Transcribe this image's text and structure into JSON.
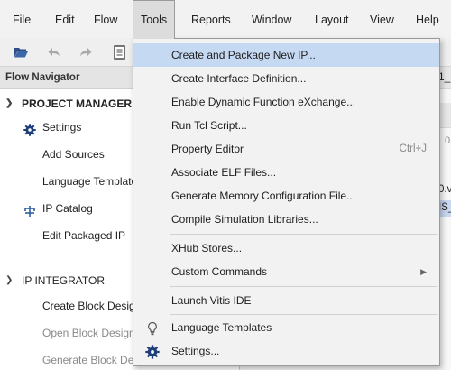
{
  "menubar": {
    "items": [
      "File",
      "Edit",
      "Flow",
      "Tools",
      "Reports",
      "Window",
      "Layout",
      "View",
      "Help"
    ],
    "active": "Tools"
  },
  "toolbar": {
    "icons": [
      "open-project-icon",
      "undo-icon",
      "redo-icon",
      "document-icon"
    ]
  },
  "flow_navigator": {
    "title": "Flow Navigator",
    "project_manager": {
      "label": "PROJECT MANAGER",
      "items": [
        {
          "label": "Settings",
          "icon": "gear-icon"
        },
        {
          "label": "Add Sources"
        },
        {
          "label": "Language Templates"
        },
        {
          "label": "IP Catalog",
          "icon": "ip-catalog-icon"
        },
        {
          "label": "Edit Packaged IP"
        }
      ]
    },
    "ip_integrator": {
      "label": "IP INTEGRATOR",
      "items": [
        {
          "label": "Create Block Design",
          "dim": false
        },
        {
          "label": "Open Block Design",
          "dim": true
        },
        {
          "label": "Generate Block Design",
          "dim": true
        }
      ]
    }
  },
  "right_panel": {
    "fragments": [
      "1_",
      "0",
      "0.v",
      "IS_"
    ]
  },
  "tools_menu": {
    "items": [
      {
        "label": "Create and Package New IP...",
        "highlight": true
      },
      {
        "label": "Create Interface Definition..."
      },
      {
        "label": "Enable Dynamic Function eXchange..."
      },
      {
        "label": "Run Tcl Script..."
      },
      {
        "label": "Property Editor",
        "shortcut": "Ctrl+J"
      },
      {
        "label": "Associate ELF Files..."
      },
      {
        "label": "Generate Memory Configuration File..."
      },
      {
        "label": "Compile Simulation Libraries..."
      },
      {
        "label": "XHub Stores..."
      },
      {
        "label": "Custom Commands",
        "submenu": true
      },
      {
        "label": "Launch Vitis IDE"
      },
      {
        "label": "Language Templates",
        "icon": "lightbulb-icon"
      },
      {
        "label": "Settings...",
        "icon": "gear-icon"
      }
    ]
  },
  "colors": {
    "menu_highlight": "#c6d9f3",
    "menu_background": "#f2f2f2",
    "panel_background": "#ffffff",
    "header_background": "#e4e4e4",
    "gear_icon": "#1f3f7a",
    "ip_icon": "#2f5fa5"
  }
}
